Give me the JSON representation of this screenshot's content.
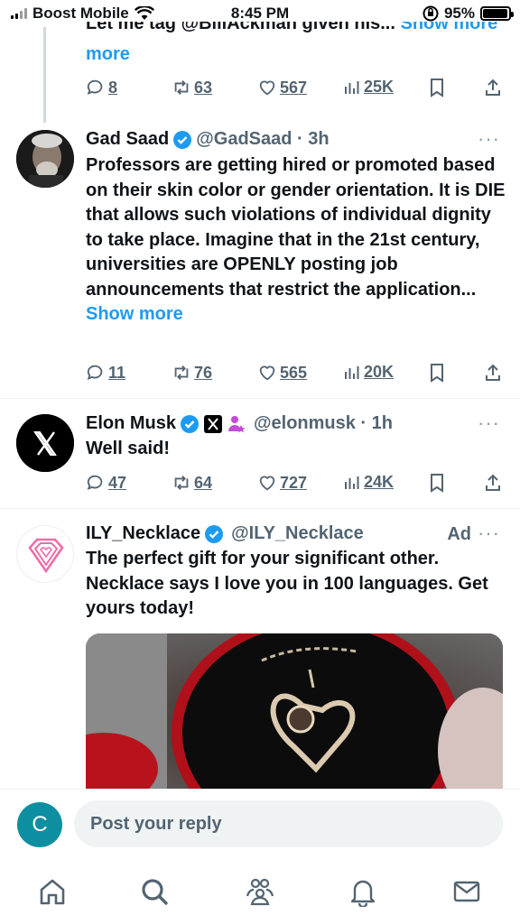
{
  "status_bar": {
    "carrier": "Boost Mobile",
    "time": "8:45 PM",
    "battery": "95%",
    "battery_level": 0.95
  },
  "prev_post": {
    "text_line1": "Let me tag @BillAckman given his...",
    "show_more": "Show more",
    "show_more_line2": "more",
    "replies": "8",
    "reposts": "63",
    "likes": "567",
    "views": "25K"
  },
  "posts": [
    {
      "name": "Gad Saad",
      "handle": "@GadSaad · 3h",
      "text": "Professors are getting hired or promoted based on their skin color or gender orientation.  It is DIE that allows such violations of individual dignity to take place.  Imagine that in the 21st century, universities are OPENLY posting job announcements that restrict the application...",
      "show_more": "Show more",
      "replies": "11",
      "reposts": "76",
      "likes": "565",
      "views": "20K"
    },
    {
      "name": "Elon Musk",
      "handle": "@elonmusk · 1h",
      "text": "Well said!",
      "replies": "47",
      "reposts": "64",
      "likes": "727",
      "views": "24K"
    },
    {
      "name": "ILY_Necklace",
      "handle": "@ILY_Necklace",
      "ad_label": "Ad",
      "text": "The perfect gift for your significant other. Necklace says I love you in 100 languages. Get yours today!"
    }
  ],
  "reply_bar": {
    "avatar_letter": "C",
    "placeholder": "Post your reply"
  },
  "nav": [
    "home-icon",
    "search-icon",
    "communities-icon",
    "notifications-icon",
    "messages-icon"
  ],
  "colors": {
    "accent": "#1d9bf0",
    "muted": "#536471",
    "reply_avatar": "#0e8fa1",
    "ad_logo": "#f06ba8"
  }
}
